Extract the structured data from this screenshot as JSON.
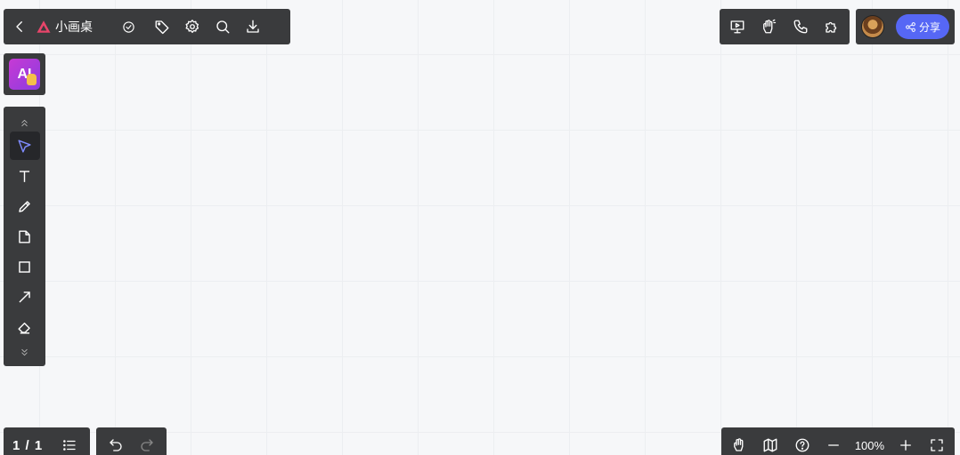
{
  "app": {
    "title": "小画桌"
  },
  "top_left": {
    "icons": [
      "back-icon",
      "logo-icon",
      "check-circle-icon",
      "tag-icon",
      "gear-icon",
      "search-icon",
      "download-icon"
    ]
  },
  "top_right": {
    "tool_icons": [
      "present-icon",
      "wave-hand-icon",
      "phone-icon",
      "puzzle-icon"
    ],
    "share_label": "分享"
  },
  "ai_button": {
    "label": "AI"
  },
  "toolbar": {
    "tools": [
      {
        "name": "select",
        "icon": "pointer-icon",
        "active": true
      },
      {
        "name": "text",
        "icon": "text-icon",
        "active": false
      },
      {
        "name": "pen",
        "icon": "pen-icon",
        "active": false
      },
      {
        "name": "sticky-note",
        "icon": "note-icon",
        "active": false
      },
      {
        "name": "rectangle",
        "icon": "rectangle-icon",
        "active": false
      },
      {
        "name": "arrow",
        "icon": "arrow-icon",
        "active": false
      },
      {
        "name": "eraser",
        "icon": "eraser-icon",
        "active": false
      }
    ],
    "accent_color": "#5667f5"
  },
  "bottom_left": {
    "page_indicator": "1 / 1"
  },
  "bottom_right": {
    "zoom": "100%"
  },
  "colors": {
    "toolbar_bg": "#3a3b3d",
    "canvas_bg": "#f6f7f9",
    "share_button": "#5667f5"
  }
}
